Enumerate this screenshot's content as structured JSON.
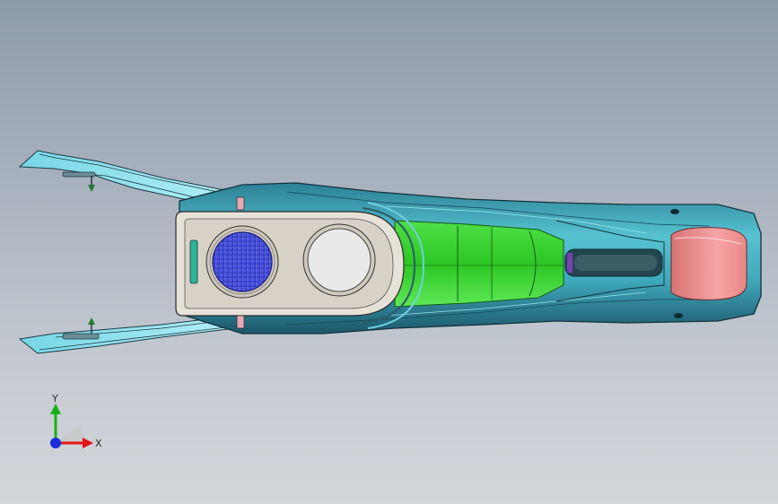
{
  "viewport": {
    "background_top": "#8e9bab",
    "background_bottom": "#d3d6da"
  },
  "model": {
    "colors": {
      "shell_dark": "#1f5d6e",
      "shell_light": "#43b6c4",
      "bracket": "#8fe3ee",
      "bezel": "#e7e2d8",
      "cup_grid": "#4a50d8",
      "tray_green": "#3bd42f",
      "end_cap": "#ef8e8e",
      "strip": "#2bb59a",
      "clip": "#e7a8b6"
    },
    "icons": {
      "triad": "axis-triad-icon",
      "pin": "pin-icon"
    }
  },
  "triad": {
    "x_label": "X",
    "y_label": "Y",
    "x_color": "#e01818",
    "y_color": "#17b017",
    "z_color": "#1a2de0"
  }
}
